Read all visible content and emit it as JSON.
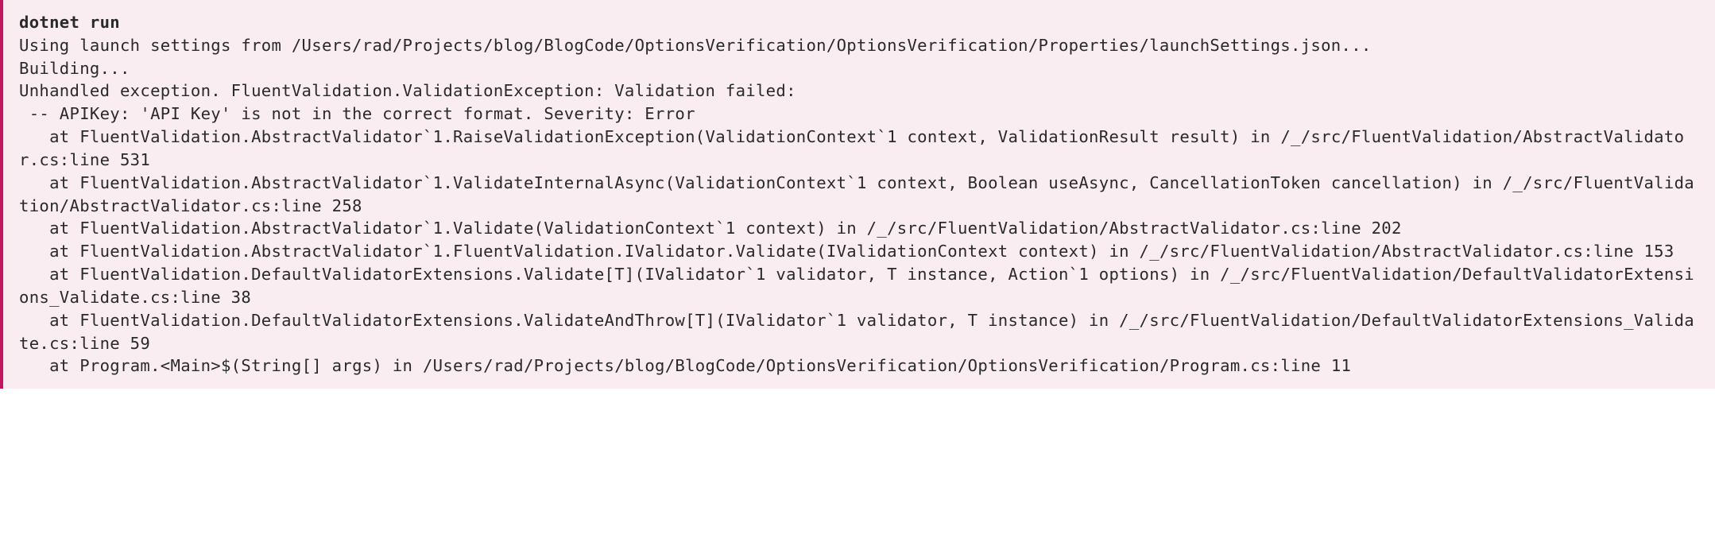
{
  "command": "dotnet run",
  "output": "Using launch settings from /Users/rad/Projects/blog/BlogCode/OptionsVerification/OptionsVerification/Properties/launchSettings.json...\nBuilding...\nUnhandled exception. FluentValidation.ValidationException: Validation failed: \n -- APIKey: 'API Key' is not in the correct format. Severity: Error\n   at FluentValidation.AbstractValidator`1.RaiseValidationException(ValidationContext`1 context, ValidationResult result) in /_/src/FluentValidation/AbstractValidator.cs:line 531\n   at FluentValidation.AbstractValidator`1.ValidateInternalAsync(ValidationContext`1 context, Boolean useAsync, CancellationToken cancellation) in /_/src/FluentValidation/AbstractValidator.cs:line 258\n   at FluentValidation.AbstractValidator`1.Validate(ValidationContext`1 context) in /_/src/FluentValidation/AbstractValidator.cs:line 202\n   at FluentValidation.AbstractValidator`1.FluentValidation.IValidator.Validate(IValidationContext context) in /_/src/FluentValidation/AbstractValidator.cs:line 153\n   at FluentValidation.DefaultValidatorExtensions.Validate[T](IValidator`1 validator, T instance, Action`1 options) in /_/src/FluentValidation/DefaultValidatorExtensions_Validate.cs:line 38\n   at FluentValidation.DefaultValidatorExtensions.ValidateAndThrow[T](IValidator`1 validator, T instance) in /_/src/FluentValidation/DefaultValidatorExtensions_Validate.cs:line 59\n   at Program.<Main>$(String[] args) in /Users/rad/Projects/blog/BlogCode/OptionsVerification/OptionsVerification/Program.cs:line 11"
}
